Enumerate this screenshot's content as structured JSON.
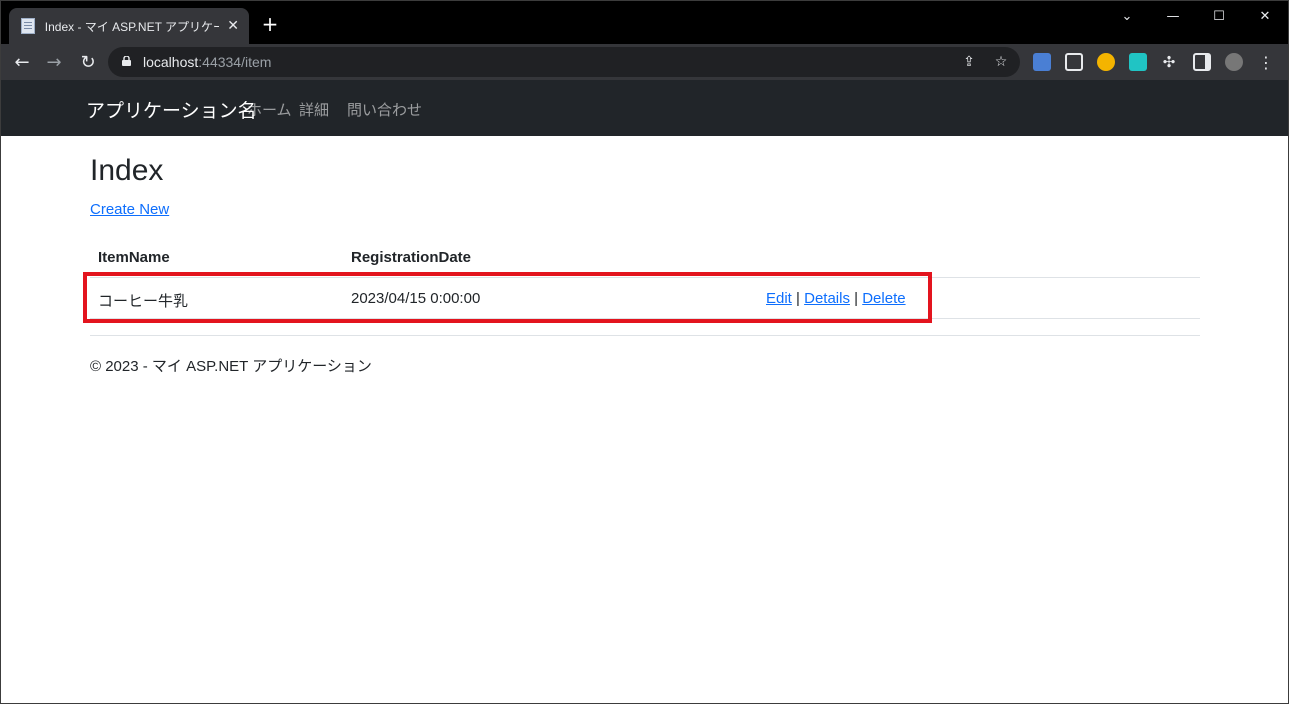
{
  "browser": {
    "tab_title": "Index - マイ ASP.NET アプリケーション",
    "tab_close": "✕",
    "new_tab": "+",
    "url_host": "localhost",
    "url_rest": ":44334/item",
    "window_controls": {
      "minimize": "—",
      "maximize": "☐",
      "close": "✕",
      "tab_search": "⌄"
    }
  },
  "navbar": {
    "brand": "アプリケーション名",
    "links": [
      "ホーム",
      "詳細",
      "問い合わせ"
    ]
  },
  "page": {
    "title": "Index",
    "create_new": "Create New"
  },
  "table": {
    "headers": [
      "ItemName",
      "RegistrationDate"
    ],
    "rows": [
      {
        "item_name": "コーヒー牛乳",
        "registration_date": "2023/04/15 0:00:00",
        "actions": [
          "Edit",
          "Details",
          "Delete"
        ],
        "separator": "|"
      }
    ]
  },
  "footer": {
    "text": "© 2023 - マイ ASP.NET アプリケーション"
  },
  "colors": {
    "highlight": "#e3141e",
    "link": "#0d6efd",
    "navbar": "#212529"
  }
}
